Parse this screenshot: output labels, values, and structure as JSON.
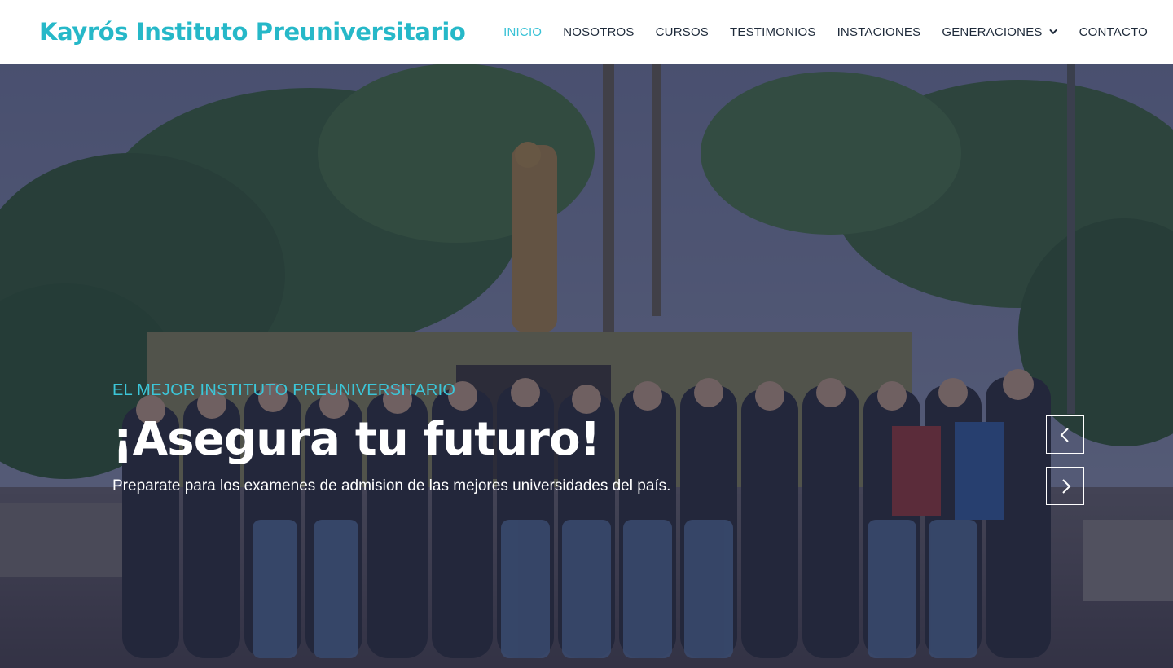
{
  "header": {
    "brand": "Kayrós Instituto Preuniversitario",
    "nav": [
      {
        "label": "INICIO",
        "active": true
      },
      {
        "label": "NOSOTROS"
      },
      {
        "label": "CURSOS"
      },
      {
        "label": "TESTIMONIOS"
      },
      {
        "label": "INSTACIONES"
      },
      {
        "label": "GENERACIONES",
        "has_dropdown": true,
        "icon": "chevron-down-icon"
      },
      {
        "label": "CONTACTO"
      }
    ]
  },
  "hero": {
    "eyebrow": "EL MEJOR INSTITUTO PREUNIVERSITARIO",
    "headline": "¡Asegura tu futuro!",
    "subline": "Preparate para los examenes de admision de las mejores universidades del país.",
    "prev_icon": "chevron-left-icon",
    "next_icon": "chevron-right-icon"
  },
  "colors": {
    "brand": "#26b8c8",
    "active_nav": "#39c2d6",
    "eyebrow": "#3cc6d8",
    "overlay": "#1c203c"
  }
}
